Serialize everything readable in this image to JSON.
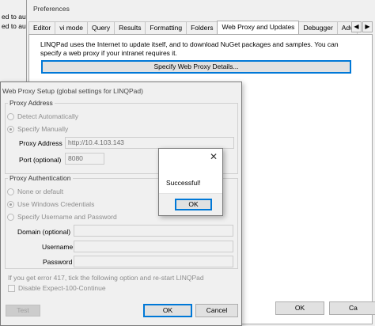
{
  "background": {
    "line1": "ed to aut",
    "line2": "ed to aut"
  },
  "preferences": {
    "title": "Preferences",
    "tabs": [
      {
        "label": "Editor",
        "active": false
      },
      {
        "label": "vi mode",
        "active": false
      },
      {
        "label": "Query",
        "active": false
      },
      {
        "label": "Results",
        "active": false
      },
      {
        "label": "Formatting",
        "active": false
      },
      {
        "label": "Folders",
        "active": false
      },
      {
        "label": "Web Proxy and Updates",
        "active": true
      },
      {
        "label": "Debugger",
        "active": false
      },
      {
        "label": "Adv",
        "active": false
      }
    ],
    "tab_arrows": {
      "left": "◀",
      "right": "▶"
    },
    "info_text": "LINQPad uses the Internet to update itself, and to download NuGet packages and samples. You can specify a web proxy if your intranet requires it.",
    "specify_proxy_button": "Specify Web Proxy Details...",
    "ok_button": "OK",
    "cancel_button": "Ca"
  },
  "proxy_setup": {
    "title": "Web Proxy Setup (global settings for LINQPad)",
    "proxy_address": {
      "legend": "Proxy Address",
      "detect_auto": "Detect Automatically",
      "specify_manual": "Specify Manually",
      "proxy_address_label": "Proxy Address",
      "proxy_address_value": "http://10.4.103.143",
      "port_label": "Port (optional)",
      "port_value": "8080"
    },
    "authentication": {
      "legend": "Proxy Authentication",
      "none": "None or default",
      "windows": "Use Windows Credentials",
      "specify": "Specify Username and Password",
      "domain_label": "Domain (optional)",
      "username_label": "Username",
      "password_label": "Password"
    },
    "note": "If you get error 417, tick the following option and re-start LINQPad",
    "disable_expect": "Disable Expect-100-Continue",
    "test_button": "Test",
    "ok_button": "OK",
    "cancel_button": "Cancel"
  },
  "message_box": {
    "close_glyph": "✕",
    "text": "Successful!",
    "ok_button": "OK"
  }
}
